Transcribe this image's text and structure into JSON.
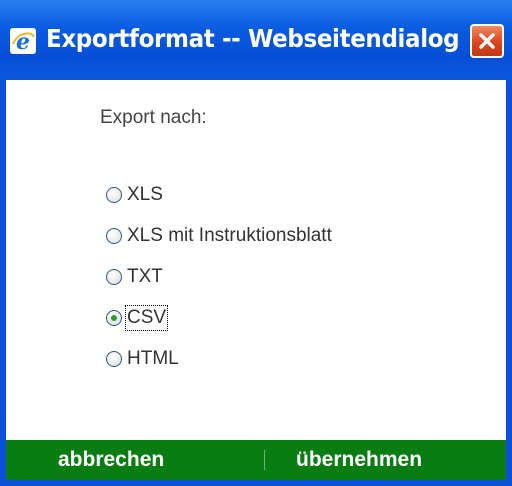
{
  "window": {
    "title": "Exportformat -- Webseitendialog",
    "app_icon": "internet-explorer-icon",
    "close_icon": "close-icon"
  },
  "dialog": {
    "heading": "Export nach:",
    "selected": "CSV",
    "options": [
      {
        "label": "XLS",
        "checked": false
      },
      {
        "label": "XLS mit Instruktionsblatt",
        "checked": false
      },
      {
        "label": "TXT",
        "checked": false
      },
      {
        "label": "CSV",
        "checked": true
      },
      {
        "label": "HTML",
        "checked": false
      }
    ]
  },
  "footer": {
    "cancel_label": "abbrechen",
    "accept_label": "übernehmen"
  },
  "colors": {
    "titlebar": "#0550d6",
    "footer": "#0a7d12",
    "close_button": "#d9451f",
    "radio_dot": "#2aa12a"
  }
}
